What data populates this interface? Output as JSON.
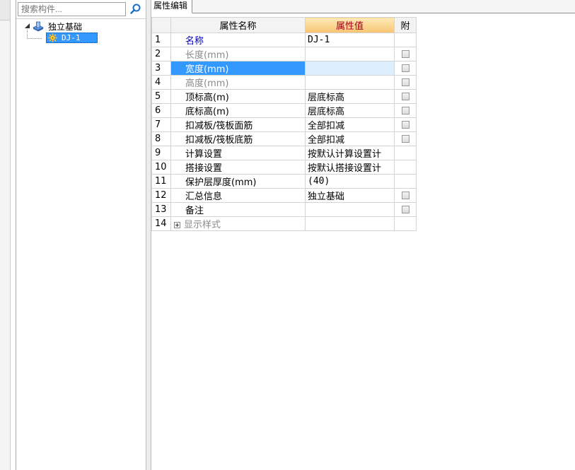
{
  "search": {
    "placeholder": "搜索构件..."
  },
  "tree": {
    "root": {
      "label": "独立基础",
      "icon": "foundation-icon",
      "expanded": true
    },
    "child": {
      "label": "DJ-1",
      "icon": "component-gear-icon",
      "selected": true
    }
  },
  "tabs": [
    {
      "label": "属性编辑",
      "active": true
    }
  ],
  "grid": {
    "headers": {
      "name": "属性名称",
      "value": "属性值",
      "attach": "附"
    },
    "rows": [
      {
        "num": "1",
        "name": "名称",
        "value": "DJ-1",
        "checkbox": false,
        "style": "blue"
      },
      {
        "num": "2",
        "name": "长度(mm)",
        "value": "",
        "checkbox": true,
        "style": "gray"
      },
      {
        "num": "3",
        "name": "宽度(mm)",
        "value": "",
        "checkbox": true,
        "style": "selected"
      },
      {
        "num": "4",
        "name": "高度(mm)",
        "value": "",
        "checkbox": true,
        "style": "gray"
      },
      {
        "num": "5",
        "name": "顶标高(m)",
        "value": "层底标高",
        "checkbox": true,
        "style": "normal"
      },
      {
        "num": "6",
        "name": "底标高(m)",
        "value": "层底标高",
        "checkbox": true,
        "style": "normal"
      },
      {
        "num": "7",
        "name": "扣减板/筏板面筋",
        "value": "全部扣减",
        "checkbox": true,
        "style": "normal"
      },
      {
        "num": "8",
        "name": "扣减板/筏板底筋",
        "value": "全部扣减",
        "checkbox": true,
        "style": "normal"
      },
      {
        "num": "9",
        "name": "计算设置",
        "value": "按默认计算设置计",
        "checkbox": false,
        "style": "normal"
      },
      {
        "num": "10",
        "name": "搭接设置",
        "value": "按默认搭接设置计",
        "checkbox": false,
        "style": "normal"
      },
      {
        "num": "11",
        "name": "保护层厚度(mm)",
        "value": "(40)",
        "checkbox": false,
        "style": "normal"
      },
      {
        "num": "12",
        "name": "汇总信息",
        "value": "独立基础",
        "checkbox": true,
        "style": "normal"
      },
      {
        "num": "13",
        "name": "备注",
        "value": "",
        "checkbox": true,
        "style": "normal"
      },
      {
        "num": "14",
        "name": "显示样式",
        "value": "",
        "checkbox": false,
        "style": "group"
      }
    ]
  },
  "colors": {
    "selection": "#3399ff",
    "header_value": "#a3001a",
    "link_blue": "#0000c0",
    "selected_row_num": "#ff5a00"
  }
}
